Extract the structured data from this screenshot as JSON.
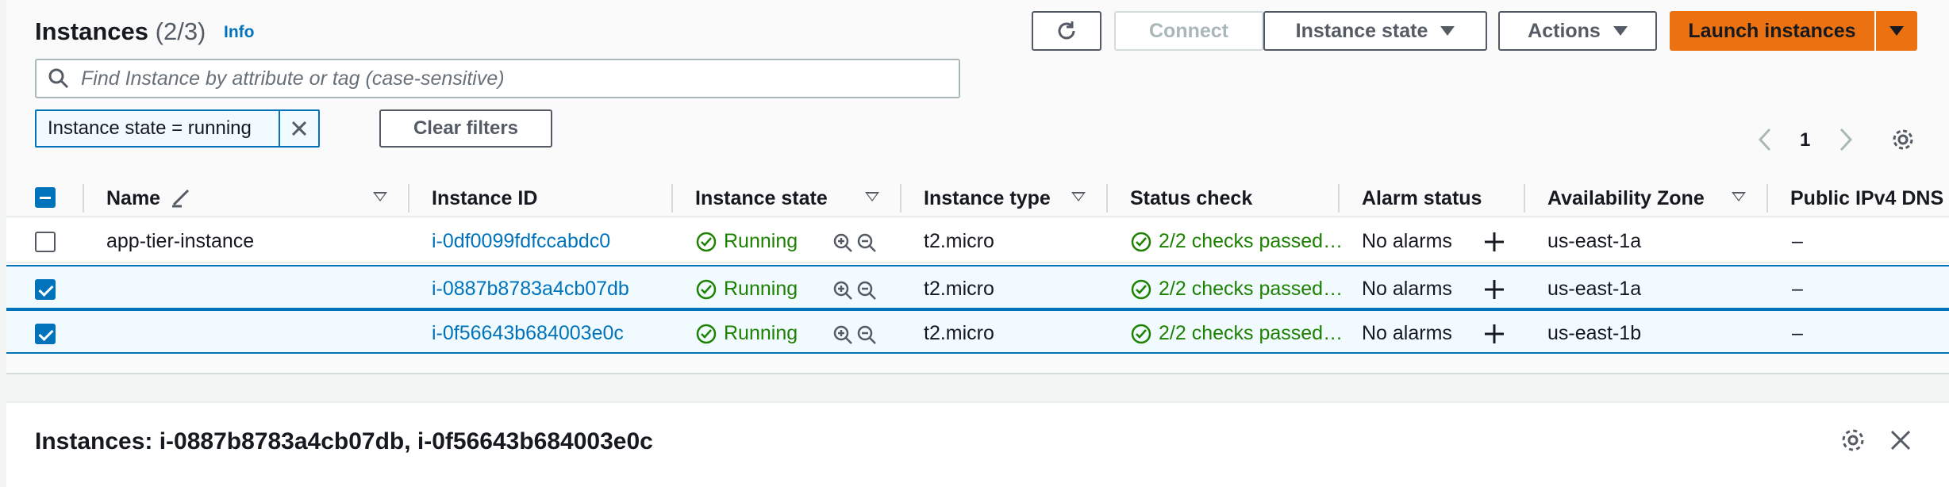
{
  "header": {
    "title": "Instances",
    "count": "(2/3)",
    "info": "Info"
  },
  "toolbar": {
    "refresh_icon": "refresh-icon",
    "connect": "Connect",
    "instance_state": "Instance state",
    "actions": "Actions",
    "launch": "Launch instances"
  },
  "search": {
    "placeholder": "Find Instance by attribute or tag (case-sensitive)",
    "value": ""
  },
  "filter": {
    "token_label": "Instance state = running",
    "clear_label": "Clear filters"
  },
  "pagination": {
    "page": "1"
  },
  "table": {
    "columns": {
      "name": "Name",
      "instance_id": "Instance ID",
      "instance_state": "Instance state",
      "instance_type": "Instance type",
      "status_check": "Status check",
      "alarm_status": "Alarm status",
      "availability_zone": "Availability Zone",
      "public_dns": "Public IPv4 DNS"
    },
    "rows": [
      {
        "name": "app-tier-instance",
        "id": "i-0df0099fdfccabdc0",
        "state": "Running",
        "type": "t2.micro",
        "status": "2/2 checks passed…",
        "alarm": "No alarms",
        "az": "us-east-1a",
        "dns": "–",
        "selected": false
      },
      {
        "name": "",
        "id": "i-0887b8783a4cb07db",
        "state": "Running",
        "type": "t2.micro",
        "status": "2/2 checks passed…",
        "alarm": "No alarms",
        "az": "us-east-1a",
        "dns": "–",
        "selected": true
      },
      {
        "name": "",
        "id": "i-0f56643b684003e0c",
        "state": "Running",
        "type": "t2.micro",
        "status": "2/2 checks passed…",
        "alarm": "No alarms",
        "az": "us-east-1b",
        "dns": "–",
        "selected": true
      }
    ]
  },
  "detail": {
    "title": "Instances: i-0887b8783a4cb07db, i-0f56643b684003e0c"
  },
  "colors": {
    "primary": "#ec7211",
    "link": "#0073bb",
    "success": "#1d8102"
  }
}
